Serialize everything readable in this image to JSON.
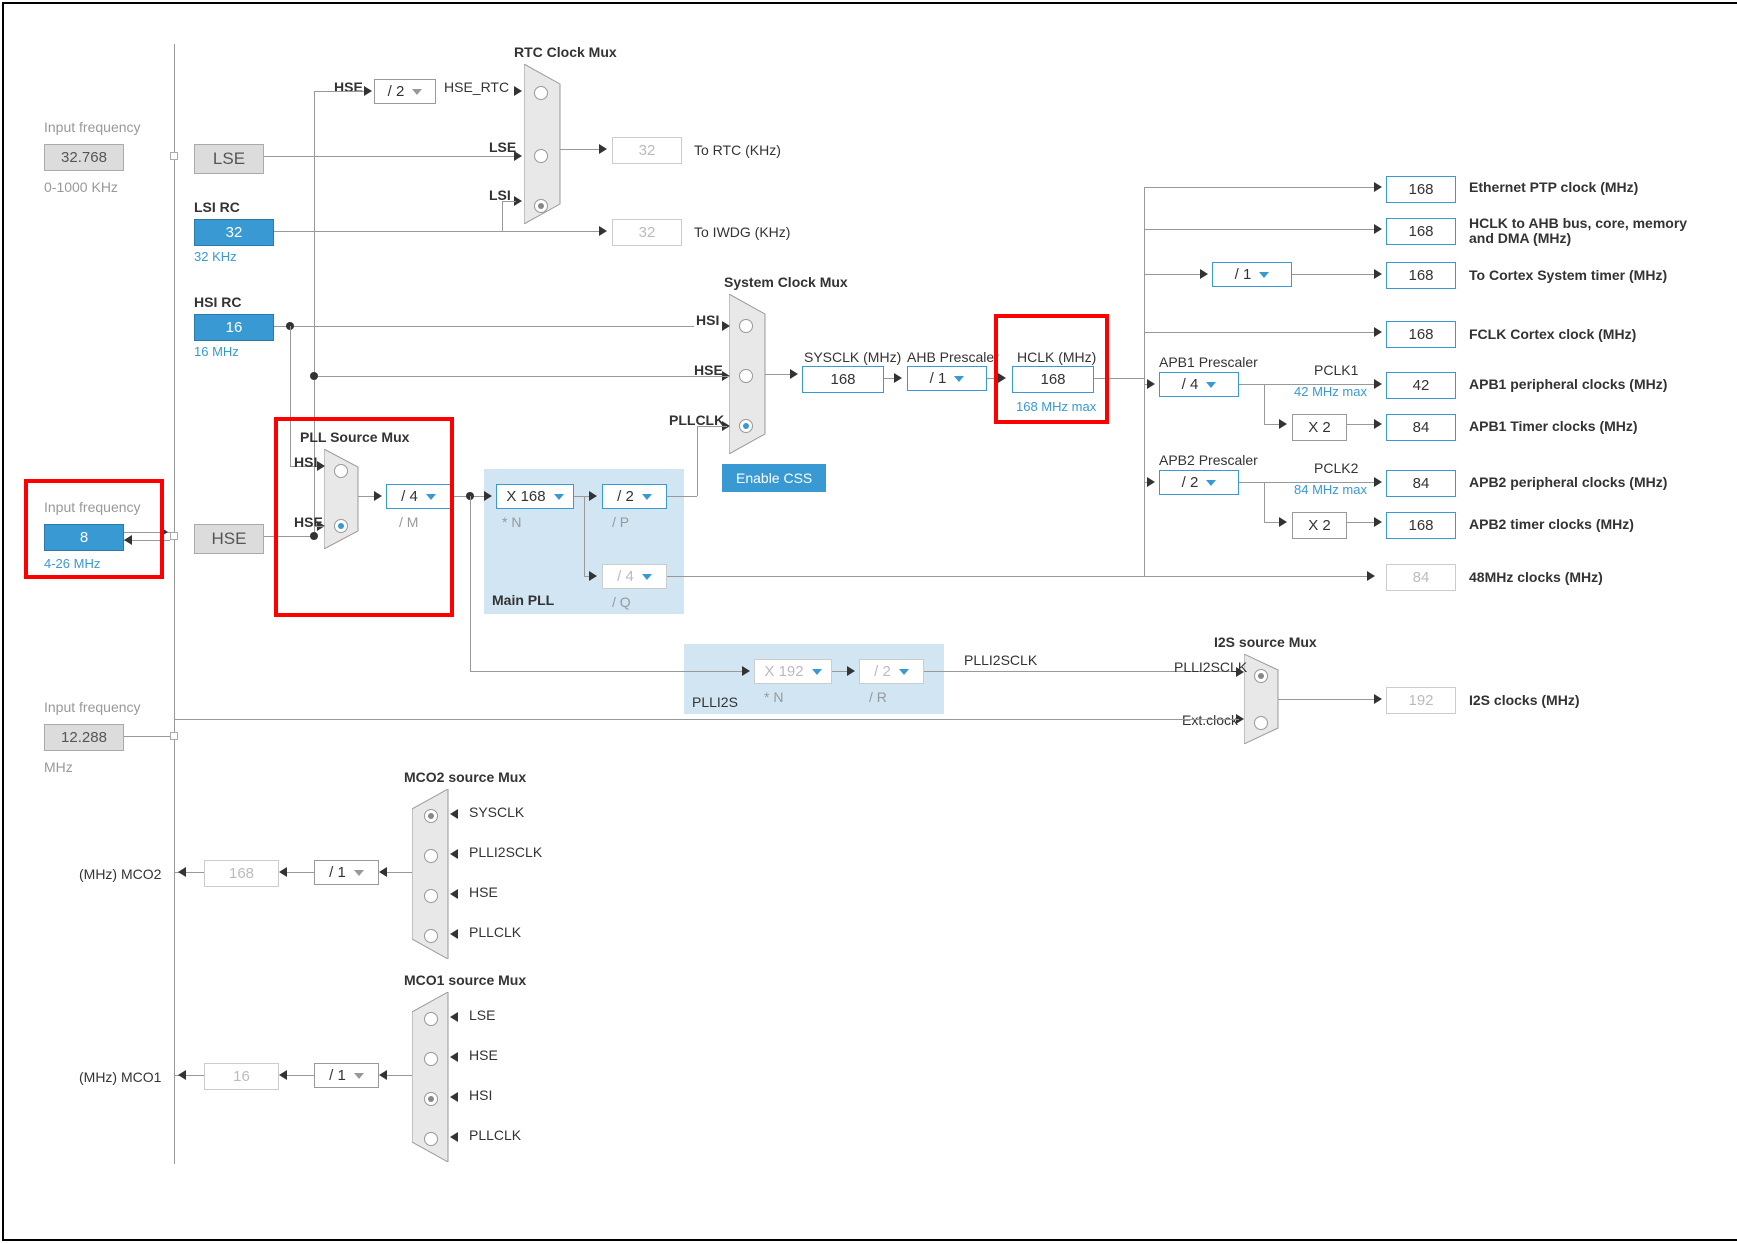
{
  "inputs": {
    "lse_label": "Input frequency",
    "lse_val": "32.768",
    "lse_range": "0-1000 KHz",
    "hse_label": "Input frequency",
    "hse_val": "8",
    "hse_range": "4-26 MHz",
    "i2s_label": "Input frequency",
    "i2s_val": "12.288",
    "i2s_unit": "MHz"
  },
  "sources": {
    "lse": "LSE",
    "lsi_title": "LSI RC",
    "lsi_val": "32",
    "lsi_sub": "32 KHz",
    "hsi_title": "HSI RC",
    "hsi_val": "16",
    "hsi_sub": "16 MHz",
    "hse": "HSE"
  },
  "rtc": {
    "title": "RTC Clock Mux",
    "hse_label": "HSE",
    "hse_div": "/ 2",
    "hse_rtc": "HSE_RTC",
    "lse_label": "LSE",
    "lsi_label": "LSI",
    "to_rtc_val": "32",
    "to_rtc_label": "To RTC (KHz)",
    "to_iwdg_val": "32",
    "to_iwdg_label": "To IWDG (KHz)"
  },
  "pll": {
    "title": "PLL Source Mux",
    "hsi_label": "HSI",
    "hse_label": "HSE",
    "div_m": "/ 4",
    "div_m_sub": "/ M",
    "main_title": "Main PLL",
    "mult_n": "X 168",
    "mult_n_sub": "* N",
    "div_p": "/ 2",
    "div_p_sub": "/ P",
    "div_q": "/ 4",
    "div_q_sub": "/ Q",
    "i2s_title": "PLLI2S",
    "i2s_n": "X 192",
    "i2s_n_sub": "* N",
    "i2s_r": "/ 2",
    "i2s_r_sub": "/ R",
    "i2s_out": "PLLI2SCLK"
  },
  "sysclk": {
    "title": "System Clock Mux",
    "hsi_label": "HSI",
    "hse_label": "HSE",
    "pllclk_label": "PLLCLK",
    "sysclk_label": "SYSCLK (MHz)",
    "sysclk_val": "168",
    "enable_css": "Enable CSS"
  },
  "ahb": {
    "prescaler_label": "AHB Prescaler",
    "prescaler_val": "/ 1",
    "hclk_label": "HCLK (MHz)",
    "hclk_val": "168",
    "hclk_max": "168 MHz max"
  },
  "outputs": {
    "eth_val": "168",
    "eth_label": "Ethernet PTP clock (MHz)",
    "ahb_val": "168",
    "ahb_label": "HCLK to AHB bus, core, memory and DMA (MHz)",
    "cortex_sys_presc": "/ 1",
    "cortex_sys_val": "168",
    "cortex_sys_label": "To Cortex System timer (MHz)",
    "fclk_val": "168",
    "fclk_label": "FCLK Cortex clock (MHz)",
    "apb1_presc_label": "APB1 Prescaler",
    "apb1_presc_val": "/ 4",
    "pclk1_label": "PCLK1",
    "pclk1_max": "42 MHz max",
    "apb1_periph_val": "42",
    "apb1_periph_label": "APB1 peripheral clocks (MHz)",
    "apb1_tim_mult": "X 2",
    "apb1_tim_val": "84",
    "apb1_tim_label": "APB1 Timer clocks (MHz)",
    "apb2_presc_label": "APB2 Prescaler",
    "apb2_presc_val": "/ 2",
    "pclk2_label": "PCLK2",
    "pclk2_max": "84 MHz max",
    "apb2_periph_val": "84",
    "apb2_periph_label": "APB2 peripheral clocks (MHz)",
    "apb2_tim_mult": "X 2",
    "apb2_tim_val": "168",
    "apb2_tim_label": "APB2 timer clocks (MHz)",
    "usb48_val": "84",
    "usb48_label": "48MHz clocks (MHz)",
    "i2s_mux_title": "I2S source Mux",
    "i2s_mux_in1": "PLLI2SCLK",
    "i2s_mux_in2": "Ext.clock",
    "i2s_val": "192",
    "i2s_label": "I2S clocks (MHz)"
  },
  "mco": {
    "mco2_mux_title": "MCO2 source Mux",
    "mco2_inputs": [
      "SYSCLK",
      "PLLI2SCLK",
      "HSE",
      "PLLCLK"
    ],
    "mco2_div": "/ 1",
    "mco2_val": "168",
    "mco2_label": "(MHz) MCO2",
    "mco1_mux_title": "MCO1 source Mux",
    "mco1_inputs": [
      "LSE",
      "HSE",
      "HSI",
      "PLLCLK"
    ],
    "mco1_div": "/ 1",
    "mco1_val": "16",
    "mco1_label": "(MHz) MCO1"
  }
}
